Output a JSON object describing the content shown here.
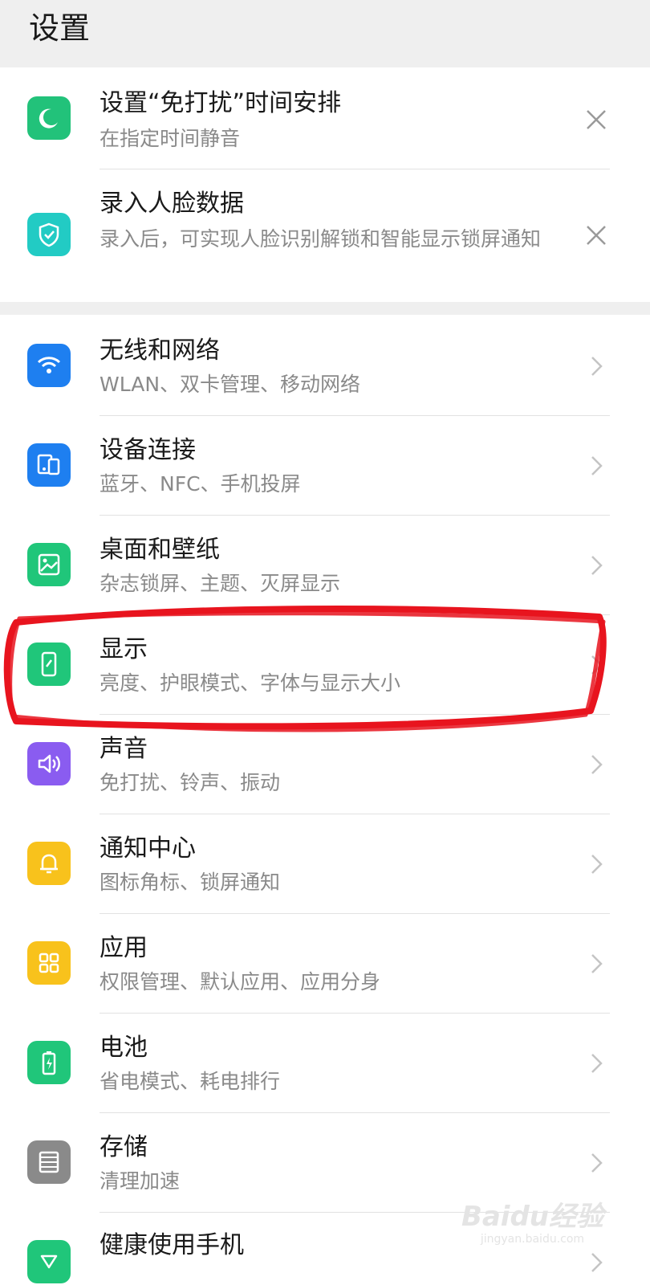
{
  "header": {
    "title": "设置"
  },
  "suggestions": [
    {
      "title": "设置“免打扰”时间安排",
      "subtitle": "在指定时间静音",
      "icon": "moon-icon",
      "color": "#22c27a"
    },
    {
      "title": "录入人脸数据",
      "subtitle": "录入后，可实现人脸识别解锁和智能显示锁屏通知",
      "icon": "shield-check-icon",
      "color": "#22cbc4"
    }
  ],
  "settings": [
    {
      "title": "无线和网络",
      "subtitle": "WLAN、双卡管理、移动网络",
      "icon": "wifi-icon",
      "color": "#1e7ff0"
    },
    {
      "title": "设备连接",
      "subtitle": "蓝牙、NFC、手机投屏",
      "icon": "device-connect-icon",
      "color": "#1e7ff0"
    },
    {
      "title": "桌面和壁纸",
      "subtitle": "杂志锁屏、主题、灭屏显示",
      "icon": "wallpaper-icon",
      "color": "#20c67a"
    },
    {
      "title": "显示",
      "subtitle": "亮度、护眼模式、字体与显示大小",
      "icon": "display-icon",
      "color": "#20c67a"
    },
    {
      "title": "声音",
      "subtitle": "免打扰、铃声、振动",
      "icon": "speaker-icon",
      "color": "#8a5cf0"
    },
    {
      "title": "通知中心",
      "subtitle": "图标角标、锁屏通知",
      "icon": "bell-icon",
      "color": "#f8c21c"
    },
    {
      "title": "应用",
      "subtitle": "权限管理、默认应用、应用分身",
      "icon": "apps-grid-icon",
      "color": "#f8c21c"
    },
    {
      "title": "电池",
      "subtitle": "省电模式、耗电排行",
      "icon": "battery-icon",
      "color": "#20c67a"
    },
    {
      "title": "存储",
      "subtitle": "清理加速",
      "icon": "storage-icon",
      "color": "#8a8a8a"
    },
    {
      "title": "健康使用手机",
      "subtitle": "",
      "icon": "health-icon",
      "color": "#20c67a"
    }
  ],
  "annotation_color": "#e8141e",
  "watermark": {
    "logo": "Baidu经验",
    "url": "jingyan.baidu.com"
  }
}
